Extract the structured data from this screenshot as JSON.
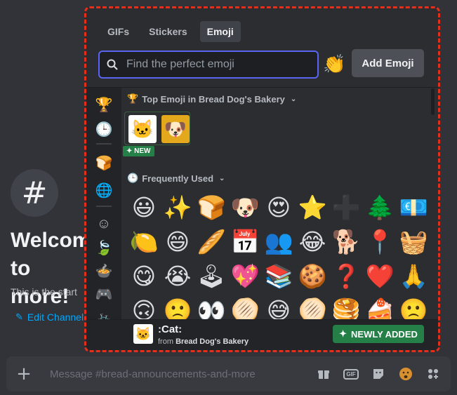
{
  "background": {
    "hash_symbol": "#",
    "welcome_title": "Welcome to\nmore!",
    "welcome_subtitle": "This is the start",
    "edit_channel": "Edit Channel"
  },
  "message_bar": {
    "plus": "+",
    "placeholder": "Message #bread-announcements-and-more",
    "gif_label": "GIF"
  },
  "picker": {
    "tabs": [
      {
        "label": "GIFs",
        "active": false
      },
      {
        "label": "Stickers",
        "active": false
      },
      {
        "label": "Emoji",
        "active": true
      }
    ],
    "search_placeholder": "Find the perfect emoji",
    "search_value": "",
    "clap_emoji": "👏",
    "add_emoji_label": "Add Emoji",
    "rail_icons": {
      "trophy": "🏆",
      "clock": "🕒",
      "bread": "🍞",
      "server": "🌐",
      "smiley": "☺",
      "leaf": "🍃",
      "food": "🍲",
      "game": "🎮",
      "bike": "🚲",
      "flag": "⚑"
    },
    "top_section": {
      "icon": "🏆",
      "title": "Top Emoji in Bread Dog's Bakery",
      "chevron": "⌄",
      "emojis": [
        "🐱",
        "🐶"
      ],
      "new_badge": "✦ NEW"
    },
    "frequent_section": {
      "icon": "🕒",
      "title": "Frequently Used",
      "chevron": "⌄"
    },
    "emoji_rows": [
      [
        "😃",
        "✨",
        "🍞",
        "🐶",
        "😍",
        "⭐",
        "➕",
        "🌲",
        "💶"
      ],
      [
        "🍋",
        "😄",
        "🥖",
        "📅",
        "👥",
        "😂",
        "🐕",
        "📍",
        "🧺"
      ],
      [
        "😋",
        "😭",
        "🕹",
        "💖",
        "📚",
        "🍪",
        "❓",
        "❤️",
        "🙏"
      ],
      [
        "🙃",
        "🙁",
        "👀",
        "🫓",
        "😅",
        "🫓",
        "🥞",
        "🍰",
        "🙁"
      ]
    ],
    "footer": {
      "emoji": "🐱",
      "name": ":Cat:",
      "from_prefix": "from",
      "from_server": "Bread Dog's Bakery",
      "newly_added": "NEWLY ADDED",
      "newly_icon": "✦"
    }
  },
  "colors": {
    "accent": "#5865f2",
    "green": "#248046",
    "highlight_border": "#e62e1a",
    "link": "#00a8fc"
  }
}
